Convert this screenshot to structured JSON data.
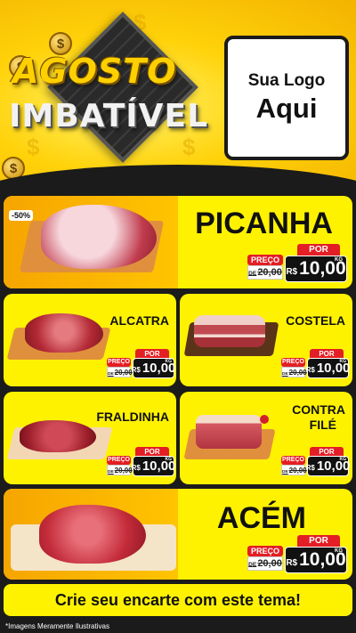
{
  "header": {
    "title_line1": "AGOSTO",
    "title_line2": "IMBATÍVEL",
    "logo_line1": "Sua Logo",
    "logo_line2": "Aqui"
  },
  "discount_badge": "-50%",
  "products": [
    {
      "name": "PICANHA",
      "por_label": "POR",
      "preco_label": "PREÇO",
      "de_label": "DE",
      "old_price": "20,00",
      "currency": "R$",
      "price": "10,00",
      "unit": "KG"
    },
    {
      "name": "ALCATRA",
      "por_label": "POR",
      "preco_label": "PREÇO",
      "de_label": "DE",
      "old_price": "20,00",
      "currency": "R$",
      "price": "10,00",
      "unit": "KG"
    },
    {
      "name": "COSTELA",
      "por_label": "POR",
      "preco_label": "PREÇO",
      "de_label": "DE",
      "old_price": "20,00",
      "currency": "R$",
      "price": "10,00",
      "unit": "KG"
    },
    {
      "name": "FRALDINHA",
      "por_label": "POR",
      "preco_label": "PREÇO",
      "de_label": "DE",
      "old_price": "20,00",
      "currency": "R$",
      "price": "10,00",
      "unit": "KG"
    },
    {
      "name_line1": "CONTRA",
      "name_line2": "FILÉ",
      "por_label": "POR",
      "preco_label": "PREÇO",
      "de_label": "DE",
      "old_price": "20,00",
      "currency": "R$",
      "price": "10,00",
      "unit": "KG"
    },
    {
      "name": "ACÉM",
      "por_label": "POR",
      "preco_label": "PREÇO",
      "de_label": "DE",
      "old_price": "20,00",
      "currency": "R$",
      "price": "10,00",
      "unit": "KG"
    }
  ],
  "cta": "Crie seu encarte com este tema!",
  "disclaimer": "*Imagens Meramente Ilustrativas",
  "colors": {
    "yellow": "#fff200",
    "orange": "#f6a500",
    "red": "#e31e24",
    "dark": "#1b1b1b"
  }
}
